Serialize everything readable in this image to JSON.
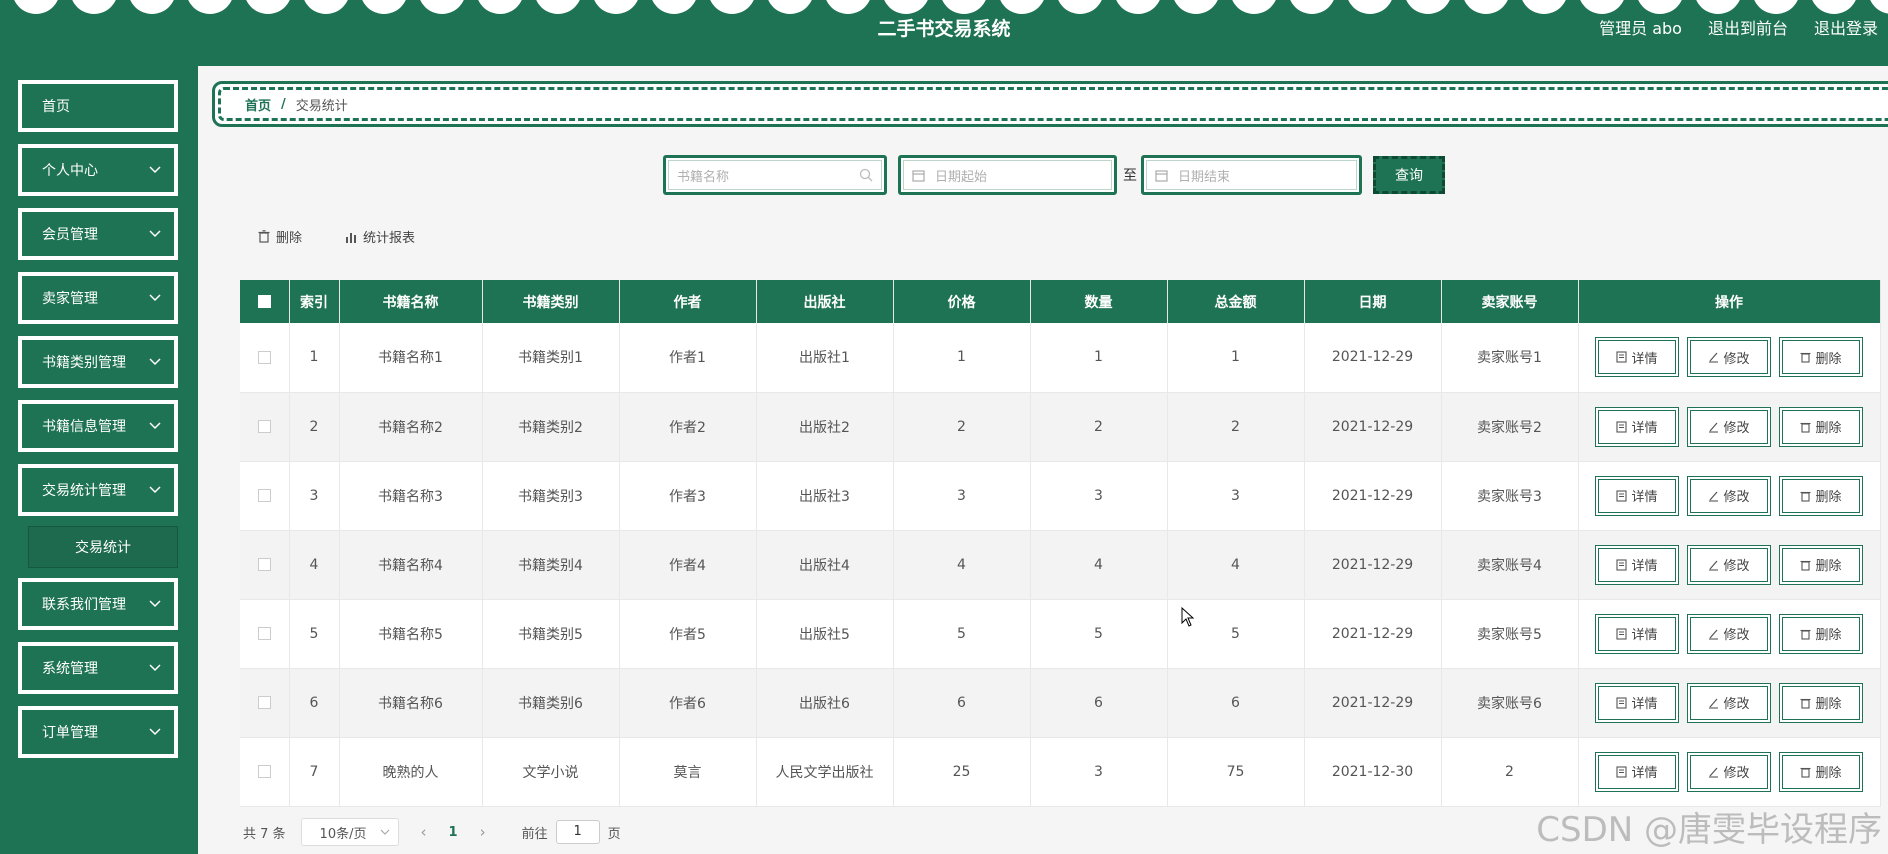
{
  "header": {
    "title": "二手书交易系统",
    "actions": [
      "管理员 abo",
      "退出到前台",
      "退出登录"
    ]
  },
  "sidebar": {
    "items": [
      {
        "label": "首页",
        "has_arrow": false
      },
      {
        "label": "个人中心",
        "has_arrow": true
      },
      {
        "label": "会员管理",
        "has_arrow": true
      },
      {
        "label": "卖家管理",
        "has_arrow": true
      },
      {
        "label": "书籍类别管理",
        "has_arrow": true
      },
      {
        "label": "书籍信息管理",
        "has_arrow": true
      },
      {
        "label": "交易统计管理",
        "has_arrow": true
      },
      {
        "label": "联系我们管理",
        "has_arrow": true
      },
      {
        "label": "系统管理",
        "has_arrow": true
      },
      {
        "label": "订单管理",
        "has_arrow": true
      }
    ],
    "submenu": {
      "label": "交易统计"
    }
  },
  "breadcrumb": {
    "home": "首页",
    "separator": "/",
    "current": "交易统计"
  },
  "search": {
    "book_name_placeholder": "书籍名称",
    "date_start_placeholder": "日期起始",
    "range_separator": "至",
    "date_end_placeholder": "日期结束",
    "query_label": "查询"
  },
  "toolbar": {
    "delete_label": "删除",
    "report_label": "统计报表"
  },
  "table": {
    "headers": [
      "索引",
      "书籍名称",
      "书籍类别",
      "作者",
      "出版社",
      "价格",
      "数量",
      "总金额",
      "日期",
      "卖家账号",
      "操作"
    ],
    "rows": [
      [
        "1",
        "书籍名称1",
        "书籍类别1",
        "作者1",
        "出版社1",
        "1",
        "1",
        "1",
        "2021-12-29",
        "卖家账号1"
      ],
      [
        "2",
        "书籍名称2",
        "书籍类别2",
        "作者2",
        "出版社2",
        "2",
        "2",
        "2",
        "2021-12-29",
        "卖家账号2"
      ],
      [
        "3",
        "书籍名称3",
        "书籍类别3",
        "作者3",
        "出版社3",
        "3",
        "3",
        "3",
        "2021-12-29",
        "卖家账号3"
      ],
      [
        "4",
        "书籍名称4",
        "书籍类别4",
        "作者4",
        "出版社4",
        "4",
        "4",
        "4",
        "2021-12-29",
        "卖家账号4"
      ],
      [
        "5",
        "书籍名称5",
        "书籍类别5",
        "作者5",
        "出版社5",
        "5",
        "5",
        "5",
        "2021-12-29",
        "卖家账号5"
      ],
      [
        "6",
        "书籍名称6",
        "书籍类别6",
        "作者6",
        "出版社6",
        "6",
        "6",
        "6",
        "2021-12-29",
        "卖家账号6"
      ],
      [
        "7",
        "晚熟的人",
        "文学小说",
        "莫言",
        "人民文学出版社",
        "25",
        "3",
        "75",
        "2021-12-30",
        "2"
      ]
    ],
    "row_actions": {
      "detail": "详情",
      "edit": "修改",
      "delete": "删除"
    }
  },
  "pagination": {
    "total": "共 7 条",
    "page_size": "10条/页",
    "current_page": "1",
    "goto_label": "前往",
    "goto_value": "1",
    "page_suffix": "页"
  },
  "watermark": "CSDN @唐雯毕设程序",
  "colors": {
    "primary": "#1f7355",
    "background": "#f5f5f5"
  }
}
